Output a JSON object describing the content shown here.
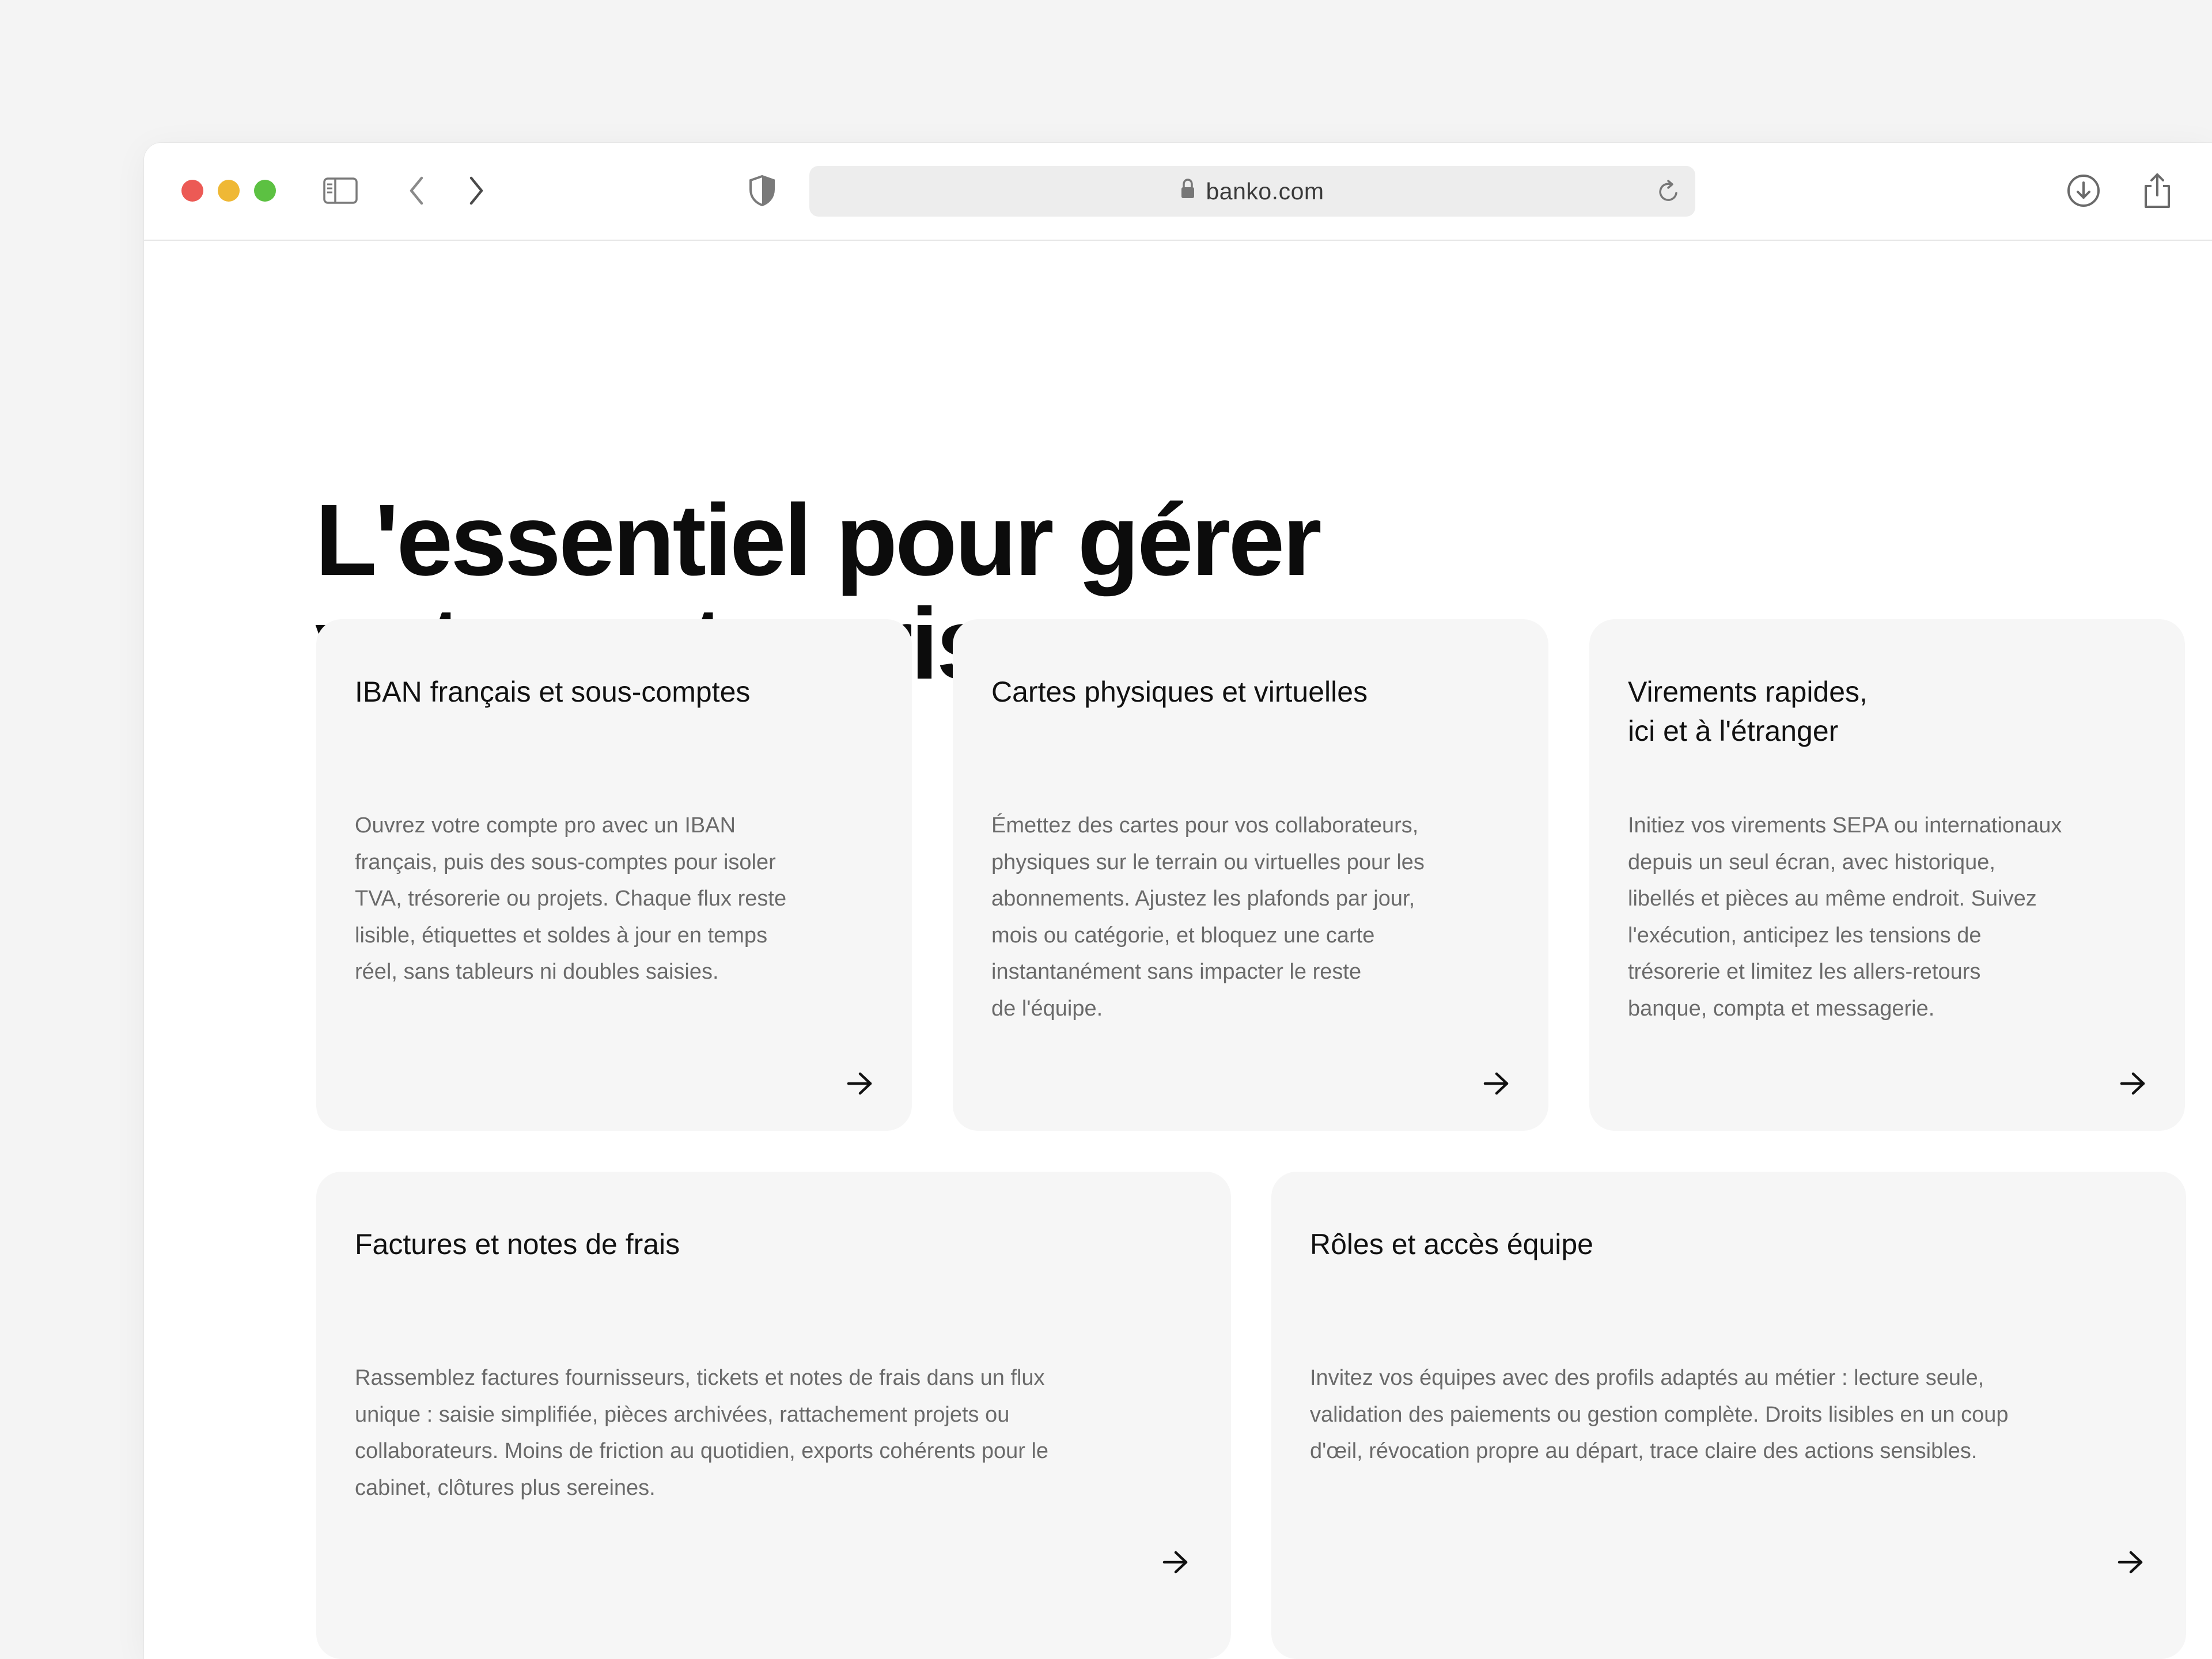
{
  "browser": {
    "url": "banko.com",
    "icons": {
      "close": "close-dot",
      "minimize": "minimize-dot",
      "zoom": "zoom-dot",
      "sidebar": "sidebar-icon",
      "back": "chevron-left-icon",
      "forward": "chevron-right-icon",
      "privacy": "shield-icon",
      "lock": "lock-icon",
      "reload": "reload-icon",
      "download": "download-icon",
      "share": "share-icon"
    },
    "colors": {
      "close": "#ec5a55",
      "minimize": "#efb835",
      "zoom": "#5cc142"
    }
  },
  "page": {
    "headline": {
      "line1": "L'essentiel pour gérer",
      "line2": "votre entreprise."
    },
    "cards": [
      {
        "title": "IBAN français et sous-comptes",
        "description": "Ouvrez votre compte pro avec un IBAN\nfrançais, puis des sous-comptes pour isoler\nTVA, trésorerie ou projets. Chaque flux reste\nlisible, étiquettes et soldes à jour en temps\nréel, sans tableurs ni doubles saisies."
      },
      {
        "title": "Cartes physiques et virtuelles",
        "description": "Émettez des cartes pour vos collaborateurs,\nphysiques sur le terrain ou virtuelles pour les\nabonnements. Ajustez les plafonds par jour,\nmois ou catégorie, et bloquez une carte\ninstantanément sans impacter le reste\nde l'équipe."
      },
      {
        "title": "Virements rapides,\nici et à l'étranger",
        "description": "Initiez vos virements SEPA ou internationaux\ndepuis un seul écran, avec historique,\nlibellés et pièces au même endroit. Suivez\nl'exécution, anticipez les tensions de\ntrésorerie et limitez les allers-retours\nbanque, compta et messagerie."
      },
      {
        "title": "Factures et notes de frais",
        "description": "Rassemblez factures fournisseurs, tickets et notes de frais dans un flux\nunique : saisie simplifiée, pièces archivées, rattachement projets ou\ncollaborateurs. Moins de friction au quotidien, exports cohérents pour le\ncabinet, clôtures plus sereines."
      },
      {
        "title": "Rôles et accès équipe",
        "description": "Invitez vos équipes avec des profils adaptés au métier : lecture seule,\nvalidation des paiements ou gestion complète. Droits lisibles en un coup\nd'œil, révocation propre au départ, trace claire des actions sensibles."
      }
    ],
    "card_arrow_icon": "arrow-right-icon"
  }
}
